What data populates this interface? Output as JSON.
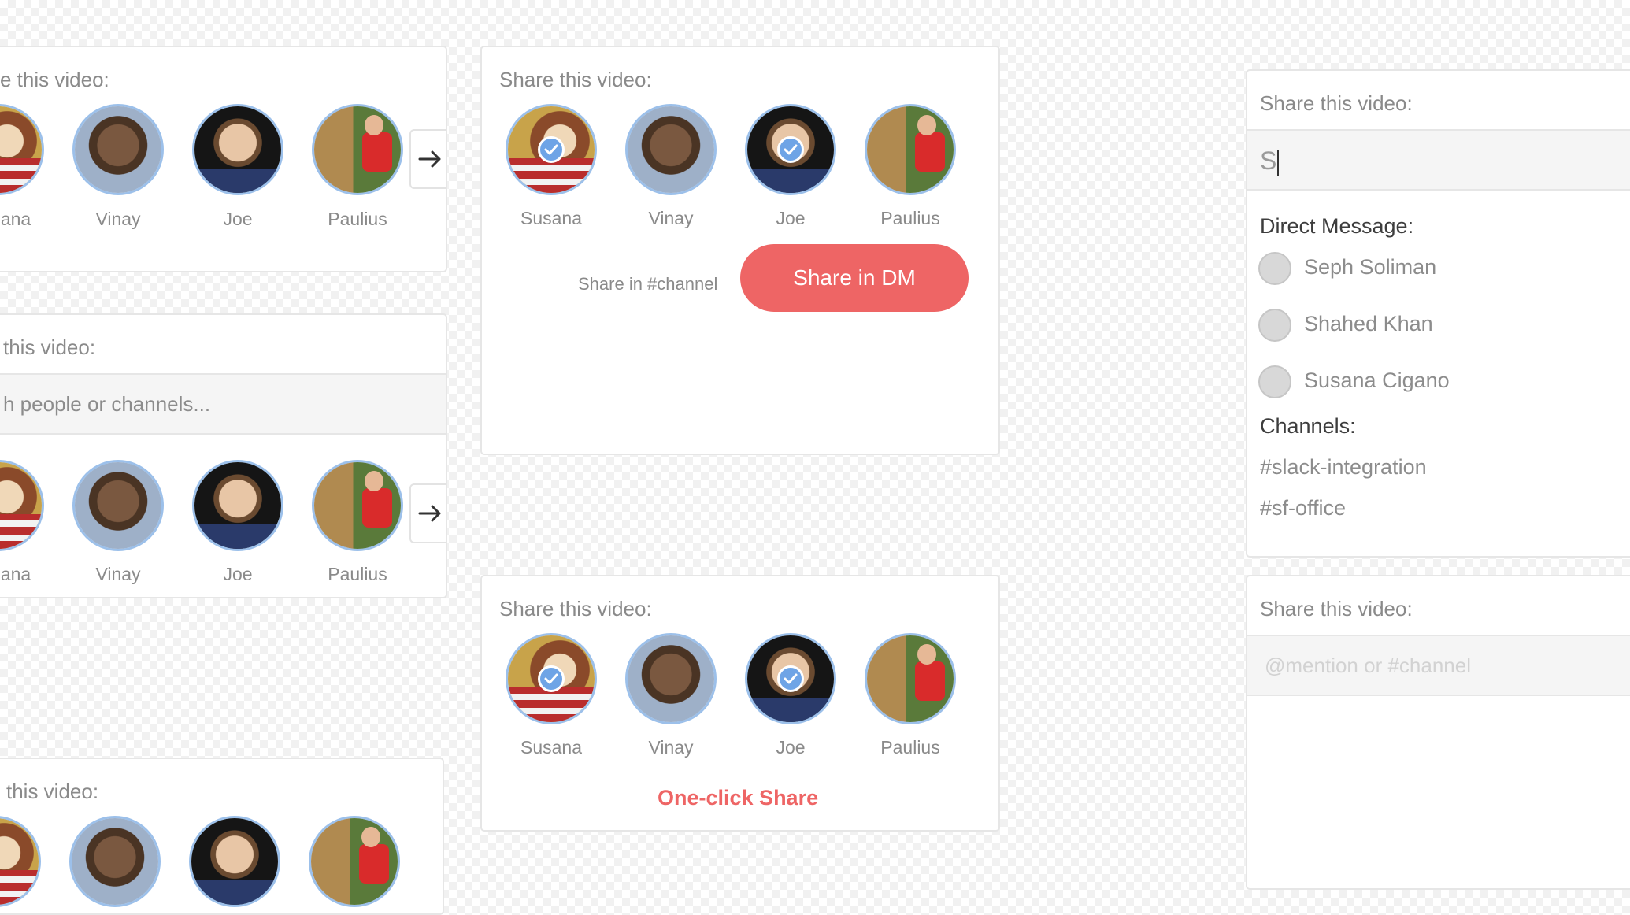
{
  "header_text": "Share this video:",
  "header_text_cropped": "e this video:",
  "header_text_cropped2": "this video:",
  "people": [
    {
      "name": "Susana",
      "icon": "avatar-susana"
    },
    {
      "name": "Vinay",
      "icon": "avatar-vinay"
    },
    {
      "name": "Joe",
      "icon": "avatar-joe"
    },
    {
      "name": "Paulius",
      "icon": "avatar-paulius"
    }
  ],
  "cropped_name": "ana",
  "search_placeholder_cropped": "h people or channels...",
  "share_channel_link": "Share in #channel",
  "share_dm_button": "Share in DM",
  "one_click_share": "One-click Share",
  "autocomplete": {
    "typed": "S",
    "dm_title": "Direct Message:",
    "dm_people": [
      "Seph Soliman",
      "Shahed Khan",
      "Susana Cigano"
    ],
    "channels_title": "Channels:",
    "channels": [
      "#slack-integration",
      "#sf-office"
    ]
  },
  "mention_placeholder": "@mention or #channel",
  "colors": {
    "accent": "#ee6565",
    "check": "#6ea4e6",
    "avatar_ring": "#9cc0ea"
  }
}
